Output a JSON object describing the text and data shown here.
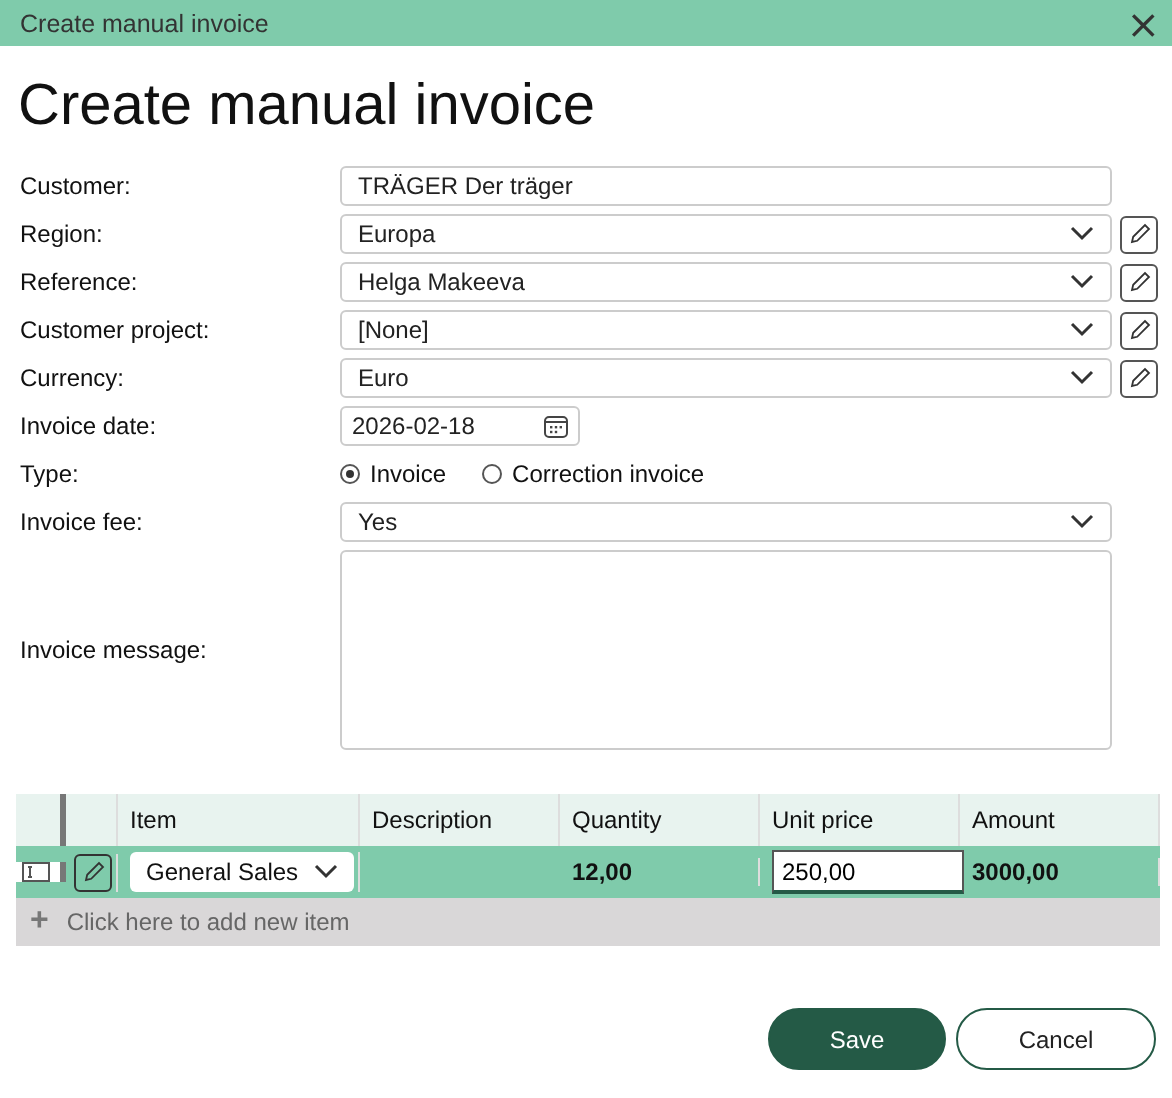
{
  "window": {
    "title": "Create manual invoice",
    "close": "×"
  },
  "heading": "Create manual invoice",
  "fields": [
    {
      "label": "Customer:",
      "kind": "text",
      "value": "TRÄGER Der träger",
      "editable": false
    },
    {
      "label": "Region:",
      "kind": "select",
      "value": "Europa",
      "editable": true
    },
    {
      "label": "Reference:",
      "kind": "select",
      "value": "Helga Makeeva",
      "editable": true
    },
    {
      "label": "Customer project:",
      "kind": "select",
      "value": "[None]",
      "editable": true
    },
    {
      "label": "Currency:",
      "kind": "select",
      "value": "Euro",
      "editable": true
    },
    {
      "label": "Invoice date:",
      "kind": "date",
      "value": "2026-02-18",
      "editable": false
    },
    {
      "label": "Type:",
      "kind": "radio",
      "options": [
        {
          "label": "Invoice",
          "selected": true
        },
        {
          "label": "Correction invoice",
          "selected": false
        }
      ],
      "editable": false
    },
    {
      "label": "Invoice fee:",
      "kind": "select",
      "value": "Yes",
      "editable": false
    },
    {
      "label": "Invoice message:",
      "kind": "textarea",
      "editable": false
    }
  ],
  "table": {
    "columns": [
      "Item",
      "Description",
      "Quantity",
      "Unit price",
      "Amount"
    ],
    "rows": [
      {
        "item": "General Sales",
        "quantity": "12,00",
        "unit_price": "250,00",
        "amount": "3000,00",
        "selected": true
      }
    ],
    "add_row": {
      "icon": "+",
      "label": "Click here to add new item"
    }
  },
  "buttons": [
    {
      "label": "Save",
      "kind": "primary"
    },
    {
      "label": "Cancel",
      "kind": "secondary"
    }
  ]
}
